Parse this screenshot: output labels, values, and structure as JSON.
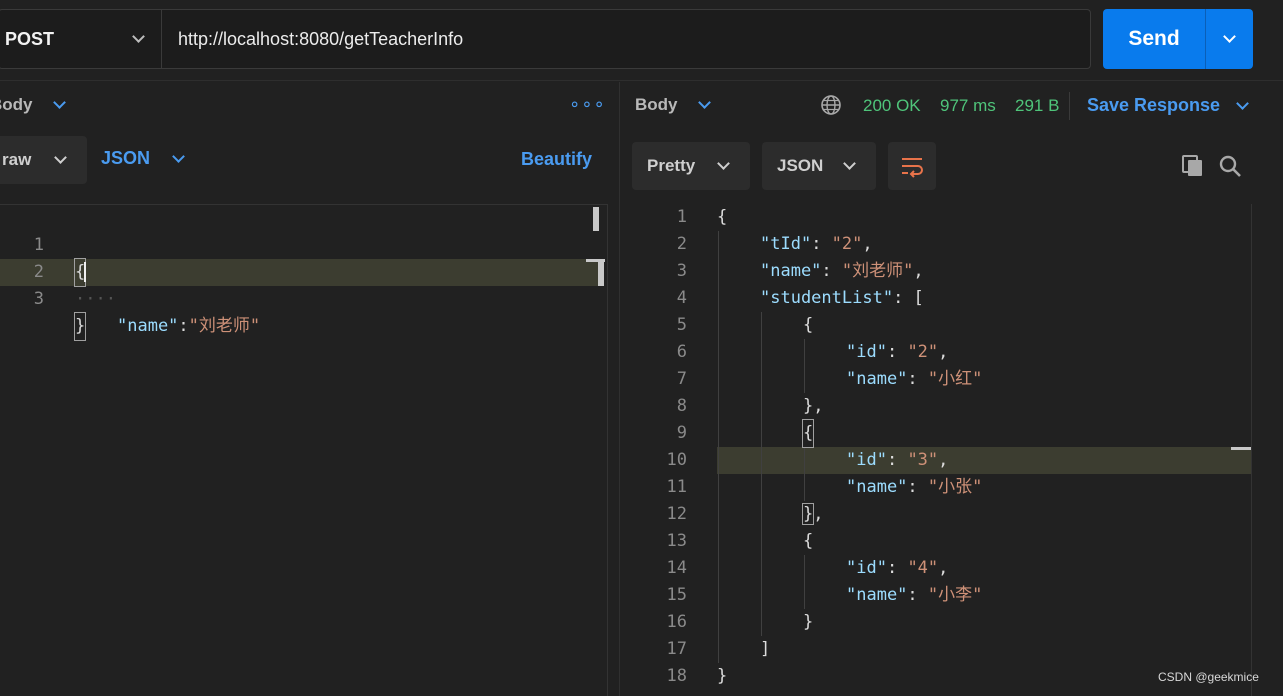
{
  "request": {
    "method": "POST",
    "url": "http://localhost:8080/getTeacherInfo",
    "send_label": "Send"
  },
  "left_pane": {
    "tab_label": "Body",
    "more_icon": "more-dots-icon",
    "body_mode": "raw",
    "language": "JSON",
    "beautify_label": "Beautify",
    "lines": [
      {
        "n": "1",
        "text": "{"
      },
      {
        "n": "2",
        "text": "\"name\":\"刘老师\""
      },
      {
        "n": "3",
        "text": "}"
      }
    ]
  },
  "right_pane": {
    "tab_label": "Body",
    "status": "200 OK",
    "time": "977 ms",
    "size": "291 B",
    "save_label": "Save Response",
    "view_mode": "Pretty",
    "language": "JSON",
    "lines": [
      {
        "n": "1",
        "text": "{"
      },
      {
        "n": "2",
        "text": "\"tId\": \"2\","
      },
      {
        "n": "3",
        "text": "\"name\": \"刘老师\","
      },
      {
        "n": "4",
        "text": "\"studentList\": ["
      },
      {
        "n": "5",
        "text": "{"
      },
      {
        "n": "6",
        "text": "\"id\": \"2\","
      },
      {
        "n": "7",
        "text": "\"name\": \"小红\""
      },
      {
        "n": "8",
        "text": "},"
      },
      {
        "n": "9",
        "text": "{"
      },
      {
        "n": "10",
        "text": "\"id\": \"3\","
      },
      {
        "n": "11",
        "text": "\"name\": \"小张\""
      },
      {
        "n": "12",
        "text": "},"
      },
      {
        "n": "13",
        "text": "{"
      },
      {
        "n": "14",
        "text": "\"id\": \"4\","
      },
      {
        "n": "15",
        "text": "\"name\": \"小李\""
      },
      {
        "n": "16",
        "text": "}"
      },
      {
        "n": "17",
        "text": "]"
      },
      {
        "n": "18",
        "text": "}"
      }
    ]
  },
  "watermark": "CSDN @geekmice",
  "colors": {
    "accent": "#097bed",
    "link": "#4a9bf0",
    "success": "#4fc47a",
    "json_key": "#9cdcfe",
    "json_string": "#ce9178",
    "line_highlight": "#3c3d30"
  }
}
